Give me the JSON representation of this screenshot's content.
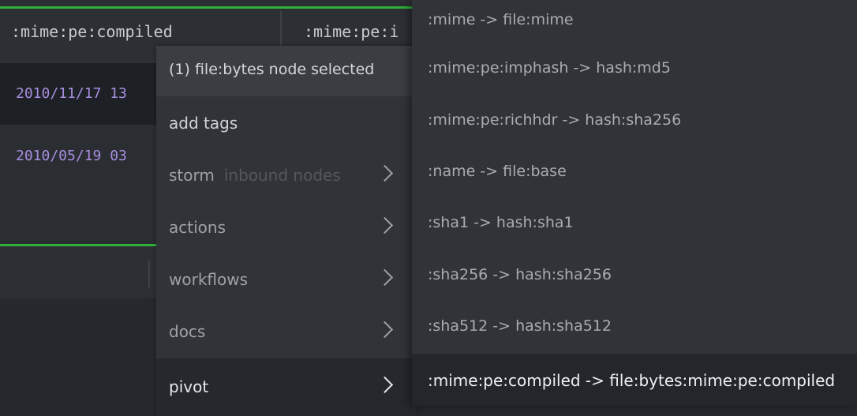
{
  "table": {
    "columns": [
      ":mime:pe:compiled",
      ":mime:pe:i"
    ],
    "rows": [
      {
        "date": "2010/11/17 13"
      },
      {
        "date": "2010/05/19 03"
      }
    ]
  },
  "menu": {
    "header": "(1) file:bytes node selected",
    "items": [
      {
        "label": "add tags",
        "sub": "",
        "has_submenu": false
      },
      {
        "label": "storm",
        "sub": "inbound nodes",
        "has_submenu": true
      },
      {
        "label": "actions",
        "sub": "",
        "has_submenu": true
      },
      {
        "label": "workflows",
        "sub": "",
        "has_submenu": true
      },
      {
        "label": "docs",
        "sub": "",
        "has_submenu": true
      },
      {
        "label": "pivot",
        "sub": "",
        "has_submenu": true,
        "active": true
      }
    ]
  },
  "submenu": {
    "items": [
      ":mime -> file:mime",
      ":mime:pe:imphash -> hash:md5",
      ":mime:pe:richhdr -> hash:sha256",
      ":name -> file:base",
      ":sha1 -> hash:sha1",
      ":sha256 -> hash:sha256",
      ":sha512 -> hash:sha512",
      ":mime:pe:compiled -> file:bytes:mime:pe:compiled"
    ],
    "highlighted_index": 7
  },
  "colors": {
    "accent_green": "#2fb236",
    "date_purple": "#a88ee0",
    "menu_bg": "#303338"
  }
}
